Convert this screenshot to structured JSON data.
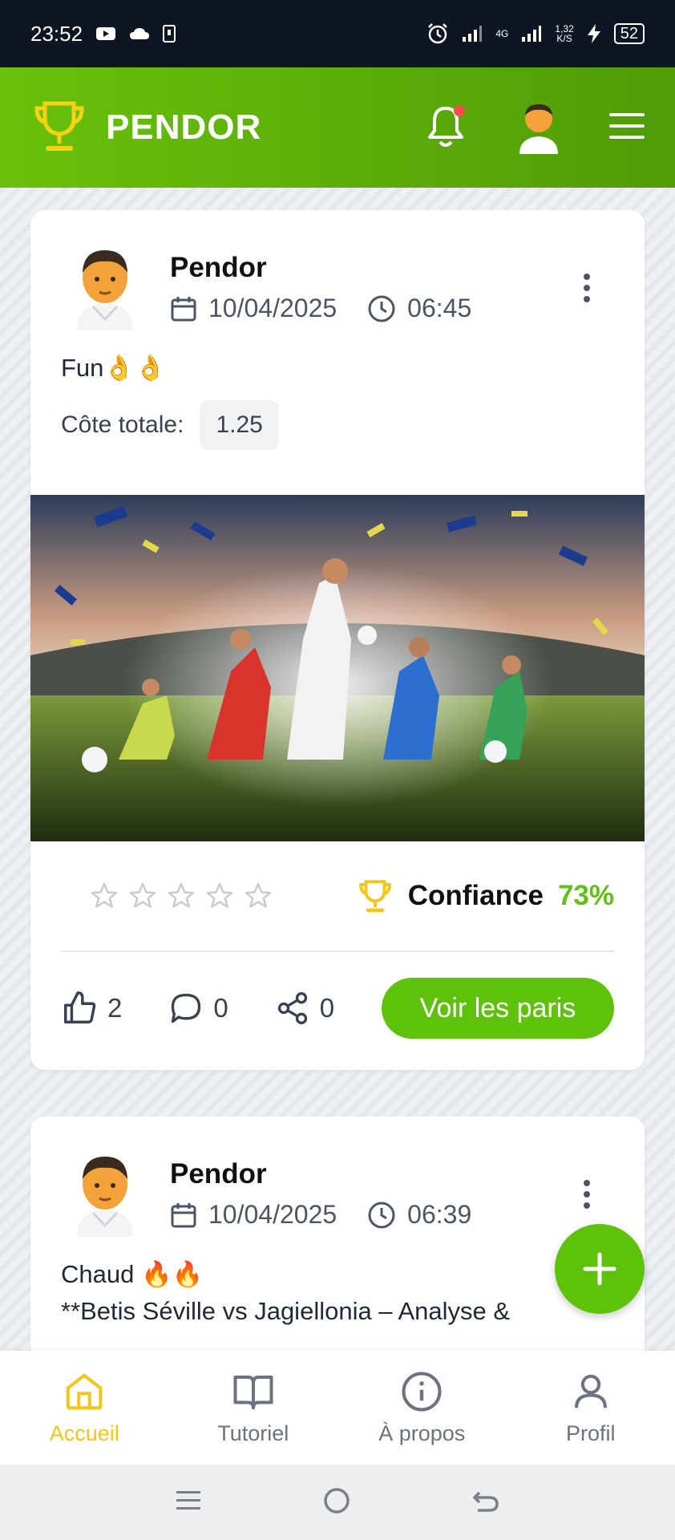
{
  "status_bar": {
    "time": "23:52",
    "network_speed": "1,32",
    "network_unit": "K/S",
    "battery": "52",
    "network_type": "4G"
  },
  "app_bar": {
    "title": "PENDOR"
  },
  "posts": [
    {
      "author": "Pendor",
      "date": "10/04/2025",
      "time": "06:45",
      "text": "Fun👌👌",
      "odds_label": "Côte totale:",
      "odds_value": "1.25",
      "rating_stars": 0,
      "confidence_label": "Confiance",
      "confidence_value": "73%",
      "likes": "2",
      "comments": "0",
      "shares": "0",
      "cta_label": "Voir les paris"
    },
    {
      "author": "Pendor",
      "date": "10/04/2025",
      "time": "06:39",
      "text_line1": "Chaud 🔥🔥",
      "text_line2": "**Betis Séville vs Jagiellonia – Analyse &"
    }
  ],
  "bottom_nav": {
    "items": [
      {
        "label": "Accueil"
      },
      {
        "label": "Tutoriel"
      },
      {
        "label": "À propos"
      },
      {
        "label": "Profil"
      }
    ]
  },
  "colors": {
    "brand_green": "#5fc20a",
    "active_nav": "#f5c518",
    "trophy_yellow": "#f5c518"
  }
}
